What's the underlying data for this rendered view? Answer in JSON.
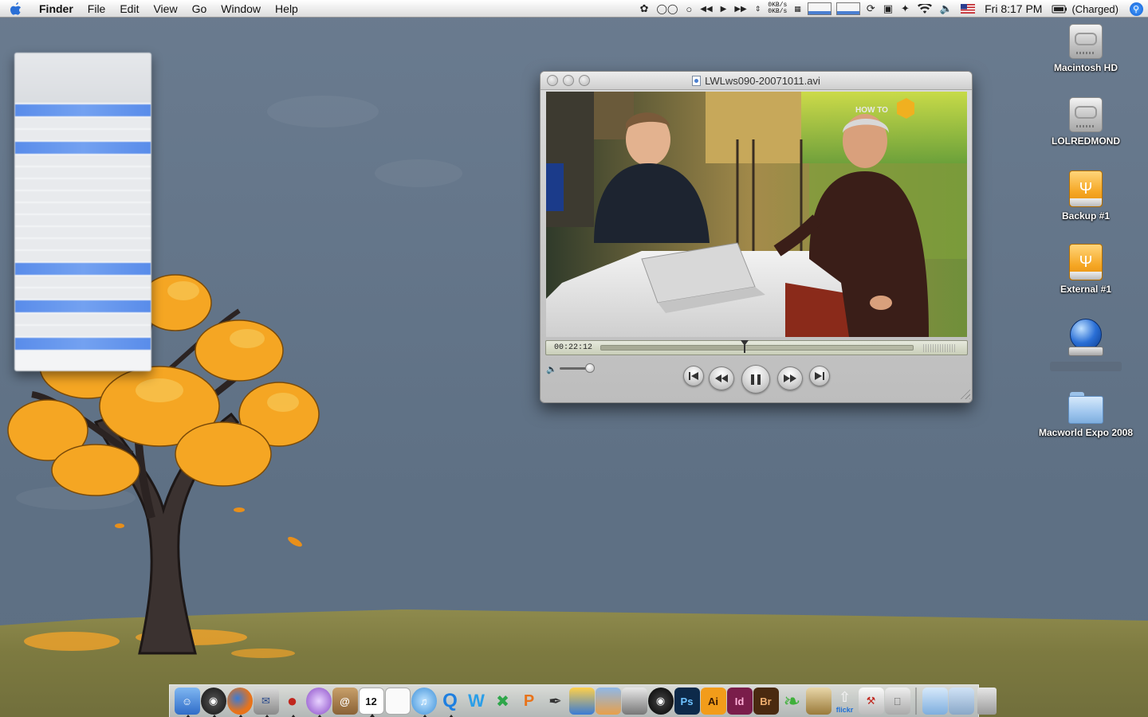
{
  "menubar": {
    "app_name": "Finder",
    "menus": [
      "File",
      "Edit",
      "View",
      "Go",
      "Window",
      "Help"
    ],
    "net_rate_up": "0KB/s",
    "net_rate_down": "0KB/s",
    "clock": "Fri 8:17 PM",
    "battery": "(Charged)"
  },
  "quicktime": {
    "title": "LWLws090-20071011.avi",
    "timecode": "00:22:12",
    "playback_position": 0.46,
    "volume_level": 0.95,
    "state": "playing",
    "video_logo_text": "HOW TO"
  },
  "desktop_icons": [
    {
      "label": "Macintosh HD",
      "icon": "hard-drive-icon",
      "type": "hd"
    },
    {
      "label": "LOLREDMOND",
      "icon": "hard-drive-icon",
      "type": "hd"
    },
    {
      "label": "Backup #1",
      "icon": "usb-drive-icon",
      "type": "usb"
    },
    {
      "label": "External #1",
      "icon": "usb-drive-icon",
      "type": "usb"
    },
    {
      "label": "",
      "icon": "network-volume-icon",
      "type": "net"
    },
    {
      "label": "Macworld Expo 2008",
      "icon": "folder-icon",
      "type": "folder"
    }
  ],
  "dock": {
    "calendar_day": "12",
    "photoshop_label": "Ps",
    "illustrator_label": "Ai",
    "indesign_label": "Id",
    "bridge_label": "Br",
    "flickr_label": "flickr"
  },
  "colors": {
    "sky": "#627487",
    "ground": "#7d7a40",
    "selection_blue": "#3e7ae8",
    "leaf_orange": "#f5a623"
  }
}
